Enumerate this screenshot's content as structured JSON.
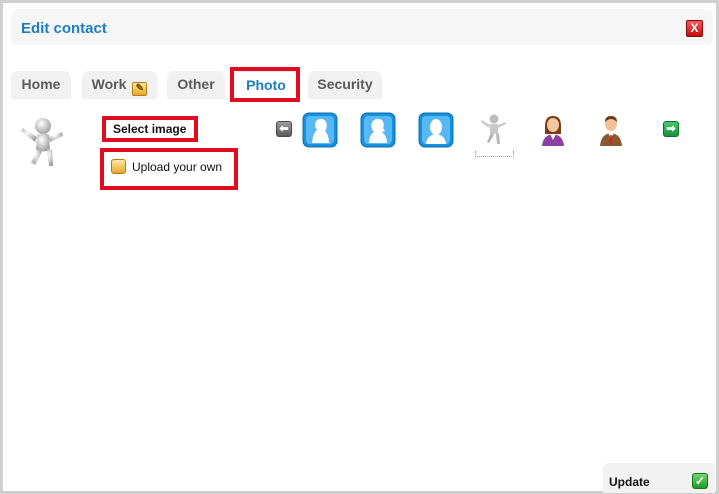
{
  "dialog": {
    "title": "Edit contact",
    "close_icon": "close-icon",
    "close_glyph": "X"
  },
  "tabs": [
    {
      "label": "Home",
      "active": false
    },
    {
      "label": "Work",
      "active": false,
      "icon": "calendar-edit-icon"
    },
    {
      "label": "Other",
      "active": false
    },
    {
      "label": "Photo",
      "active": true
    },
    {
      "label": "Security",
      "active": false
    }
  ],
  "photo_panel": {
    "current_photo_icon": "jumping-figure-icon",
    "select_label": "Select image",
    "upload_label": "Upload your own",
    "upload_icon": "upload-icon",
    "prev_icon": "arrow-left-icon",
    "next_icon": "arrow-right-icon",
    "prev_glyph": "⬅",
    "next_glyph": "➡",
    "avatars": [
      {
        "name": "silhouette-profile-left-icon",
        "selected": false
      },
      {
        "name": "silhouette-profile-right-icon",
        "selected": false
      },
      {
        "name": "silhouette-front-icon",
        "selected": false
      },
      {
        "name": "jumping-figure-icon",
        "selected": true
      },
      {
        "name": "woman-avatar-icon",
        "selected": false
      },
      {
        "name": "man-avatar-icon",
        "selected": false
      }
    ]
  },
  "footer": {
    "update_label": "Update",
    "update_icon": "checkmark-icon",
    "update_glyph": "✓"
  },
  "colors": {
    "accent_blue": "#1a7fc0",
    "highlight_red": "#e10c1f",
    "tab_bg": "#f1f1f1"
  }
}
